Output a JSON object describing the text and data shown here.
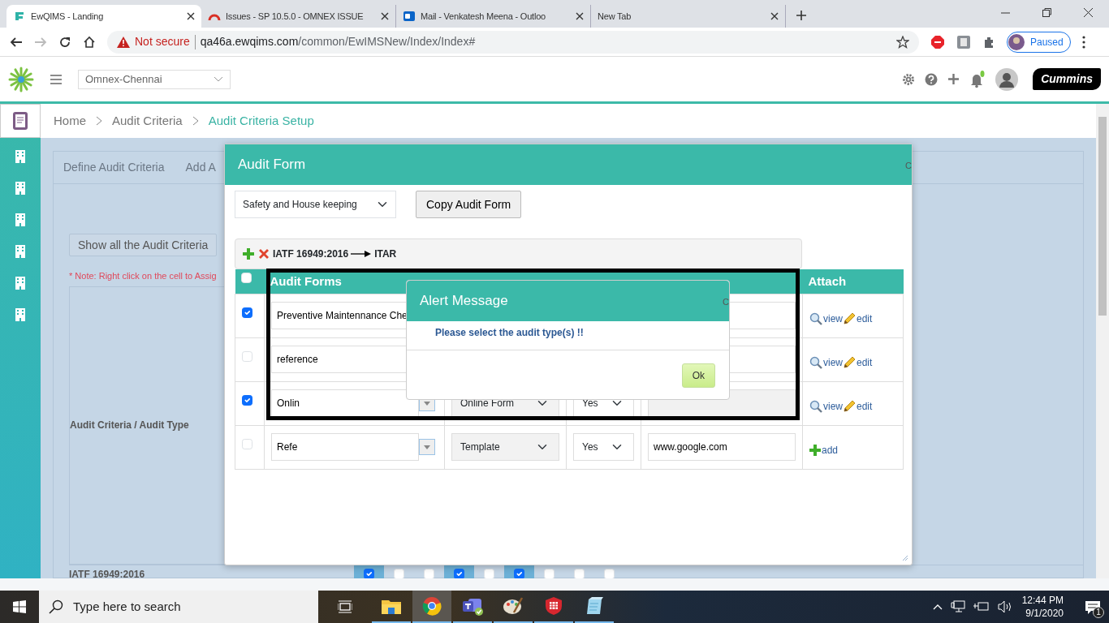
{
  "browser": {
    "tabs": [
      {
        "kind": "ewqims",
        "title": "EwQIMS - Landing",
        "selected": true
      },
      {
        "kind": "issues",
        "title": "Issues - SP 10.5.0 - OMNEX ISSUE",
        "selected": false
      },
      {
        "kind": "outlook",
        "title": "Mail - Venkatesh Meena - Outloo",
        "selected": false
      },
      {
        "kind": "blank",
        "title": "New Tab",
        "selected": false
      }
    ],
    "security": "Not secure",
    "url_host": "qa46a.ewqims.com",
    "url_path": "/common/EwIMSNew/Index/Index#",
    "profile_status": "Paused"
  },
  "header": {
    "location": "Omnex-Chennai",
    "logo_text": "Cummins",
    "notification_dot": true
  },
  "sidebar": [
    {
      "kind": "clipboard",
      "selected": true
    },
    {
      "kind": "building",
      "selected": false
    },
    {
      "kind": "building",
      "selected": false
    },
    {
      "kind": "building",
      "selected": false
    },
    {
      "kind": "building",
      "selected": false
    },
    {
      "kind": "building",
      "selected": false
    },
    {
      "kind": "building",
      "selected": false
    }
  ],
  "breadcrumb": [
    {
      "label": "Home",
      "current": false
    },
    {
      "label": "Audit Criteria",
      "current": false
    },
    {
      "label": "Audit Criteria Setup",
      "current": true
    }
  ],
  "criteria_panel": {
    "tabs": [
      "Define Audit Criteria",
      "Add A"
    ],
    "show_all_button": "Show all the Audit Criteria",
    "note": "* Note: Right click on the cell to Assig",
    "row_header": "Audit Criteria / Audit Type",
    "rows": [
      {
        "label": "IATF 16949:2016",
        "cells": [
          {
            "checked": true
          },
          {
            "checked": false
          },
          {
            "checked": false
          },
          {
            "checked": true
          },
          {
            "checked": false
          },
          {
            "checked": true
          },
          {
            "checked": false
          },
          {
            "checked": false
          },
          {
            "checked": false
          }
        ]
      }
    ]
  },
  "audit_form": {
    "title": "Audit Form",
    "close_label": "C",
    "category": "Safety and House keeping",
    "copy_button": "Copy Audit Form",
    "mapping_from": "IATF 16949:2016",
    "mapping_to": "ITAR",
    "select_all_checked": false,
    "columns": [
      "Audit Forms",
      "Attach"
    ],
    "rows": [
      {
        "checked": true,
        "form": "Preventive Maintennance Che",
        "link_disabled": false,
        "attach": [
          {
            "kind": "view",
            "label": "view"
          },
          {
            "kind": "edit",
            "label": "edit"
          }
        ]
      },
      {
        "checked": false,
        "form": "reference",
        "link_disabled": false,
        "attach": [
          {
            "kind": "view",
            "label": "view"
          },
          {
            "kind": "edit",
            "label": "edit"
          }
        ]
      },
      {
        "checked": true,
        "form": "Onlin",
        "form_type": "Online Form",
        "itar": "Yes",
        "link_disabled": true,
        "attach": [
          {
            "kind": "view",
            "label": "view"
          },
          {
            "kind": "edit",
            "label": "edit"
          }
        ]
      },
      {
        "checked": false,
        "form": "Refe",
        "form_type": "Template",
        "itar": "Yes",
        "link": "www.google.com",
        "link_disabled": false,
        "attach": [
          {
            "kind": "add",
            "label": "add"
          }
        ]
      }
    ]
  },
  "alert": {
    "title": "Alert Message",
    "close_label": "C",
    "message": "Please select the audit type(s) !!",
    "button": "Ok"
  },
  "taskbar": {
    "search_placeholder": "Type here to search",
    "apps": [
      {
        "kind": "explorer",
        "running": true,
        "selected": false
      },
      {
        "kind": "chrome",
        "running": true,
        "selected": true
      },
      {
        "kind": "teams",
        "running": true,
        "selected": false
      },
      {
        "kind": "paint",
        "running": true,
        "selected": false
      },
      {
        "kind": "shield",
        "running": true,
        "selected": false
      },
      {
        "kind": "notepad",
        "running": true,
        "selected": false
      }
    ],
    "time": "12:44 PM",
    "date": "9/1/2020",
    "notifications": "1"
  }
}
